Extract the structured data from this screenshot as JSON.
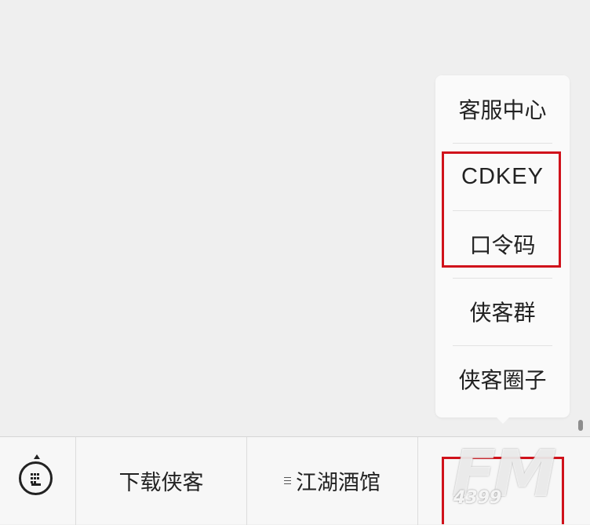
{
  "popup_menu": {
    "items": [
      {
        "label": "客服中心"
      },
      {
        "label": "CDKEY"
      },
      {
        "label": "口令码"
      },
      {
        "label": "侠客群"
      },
      {
        "label": "侠客圈子"
      }
    ]
  },
  "bottom_bar": {
    "keyboard_icon": "keyboard-icon",
    "tabs": [
      {
        "label": "下载侠客",
        "icon": ""
      },
      {
        "label": "江湖酒馆",
        "icon": "menu-lines-icon"
      }
    ]
  },
  "watermark": {
    "main": "FM",
    "sub": "4399"
  },
  "colors": {
    "highlight": "#d0121b",
    "background": "#efefef",
    "menu_background": "#fafafa"
  }
}
